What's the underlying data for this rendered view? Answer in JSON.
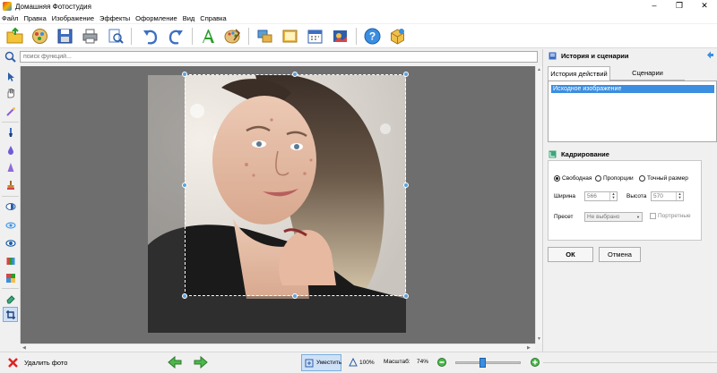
{
  "app": {
    "title": "Домашняя Фотостудия"
  },
  "menu": [
    "Файл",
    "Правка",
    "Изображение",
    "Эффекты",
    "Оформление",
    "Вид",
    "Справка"
  ],
  "search": {
    "placeholder": "поиск функций..."
  },
  "history_panel": {
    "title": "История и сценарии",
    "tabs": [
      "История действий",
      "Сценарии"
    ],
    "items": [
      "Исходное изображение"
    ]
  },
  "crop_panel": {
    "title": "Кадрирование",
    "modes": [
      "Свободная",
      "Пропорции",
      "Точный размер"
    ],
    "selected_mode": "Свободная",
    "width_label": "Ширина",
    "width_value": "566",
    "height_label": "Высота",
    "height_value": "570",
    "preset_label": "Пресет",
    "preset_value": "Не выбрано",
    "portrait_label": "Портретные",
    "ok_label": "ОК",
    "cancel_label": "Отмена"
  },
  "bottom": {
    "delete_label": "Удалить фото",
    "fit_label": "Уместить",
    "zoom100_label": "100%",
    "scale_label": "Масштаб:",
    "scale_value": "74%",
    "zoom_slider_level": 0.4
  },
  "colors": {
    "accent": "#3b8ee0",
    "canvas": "#6e6e6e"
  }
}
